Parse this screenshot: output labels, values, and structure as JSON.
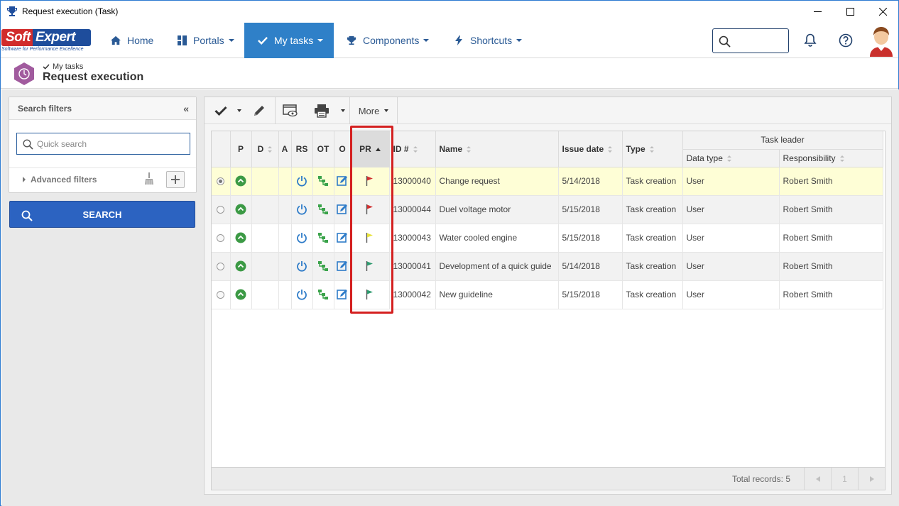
{
  "window": {
    "title": "Request execution (Task)"
  },
  "brand": {
    "name_part1": "Soft",
    "name_part2": "Expert",
    "tagline": "Software for Performance Excellence",
    "primary_color": "#1e4d9c",
    "accent_color": "#d12c2c"
  },
  "nav": {
    "items": [
      {
        "label": "Home",
        "icon": "home-icon"
      },
      {
        "label": "Portals",
        "icon": "portals-icon"
      },
      {
        "label": "My tasks",
        "icon": "check-icon",
        "active": true
      },
      {
        "label": "Components",
        "icon": "trophy-icon"
      },
      {
        "label": "Shortcuts",
        "icon": "bolt-icon"
      }
    ],
    "active_color": "#2f80c8"
  },
  "page": {
    "breadcrumb": "My tasks",
    "title": "Request execution"
  },
  "filters": {
    "header": "Search filters",
    "quick_search_placeholder": "Quick search",
    "advanced_label": "Advanced filters",
    "search_button": "SEARCH"
  },
  "toolbar": {
    "more_label": "More"
  },
  "grid": {
    "columns": {
      "p": "P",
      "d": "D",
      "a": "A",
      "rs": "RS",
      "ot": "OT",
      "o": "O",
      "pr": "PR",
      "id": "ID #",
      "name": "Name",
      "issue_date": "Issue date",
      "type": "Type",
      "group": "Task leader",
      "data_type": "Data type",
      "responsibility": "Responsibility"
    },
    "rows": [
      {
        "selected": true,
        "flag_color": "#d03030",
        "id": "13000040",
        "name": "Change request",
        "issue_date": "5/14/2018",
        "type": "Task creation",
        "data_type": "User",
        "responsibility": "Robert Smith"
      },
      {
        "selected": false,
        "flag_color": "#d03030",
        "id": "13000044",
        "name": "Duel voltage motor",
        "issue_date": "5/15/2018",
        "type": "Task creation",
        "data_type": "User",
        "responsibility": "Robert Smith"
      },
      {
        "selected": false,
        "flag_color": "#e8e23a",
        "id": "13000043",
        "name": "Water cooled engine",
        "issue_date": "5/15/2018",
        "type": "Task creation",
        "data_type": "User",
        "responsibility": "Robert Smith"
      },
      {
        "selected": false,
        "flag_color": "#2e9a6e",
        "id": "13000041",
        "name": "Development of a quick guide",
        "issue_date": "5/14/2018",
        "type": "Task creation",
        "data_type": "User",
        "responsibility": "Robert Smith"
      },
      {
        "selected": false,
        "flag_color": "#2e9a6e",
        "id": "13000042",
        "name": "New guideline",
        "issue_date": "5/15/2018",
        "type": "Task creation",
        "data_type": "User",
        "responsibility": "Robert Smith"
      }
    ],
    "footer": {
      "total": "Total records: 5",
      "page": "1"
    }
  }
}
